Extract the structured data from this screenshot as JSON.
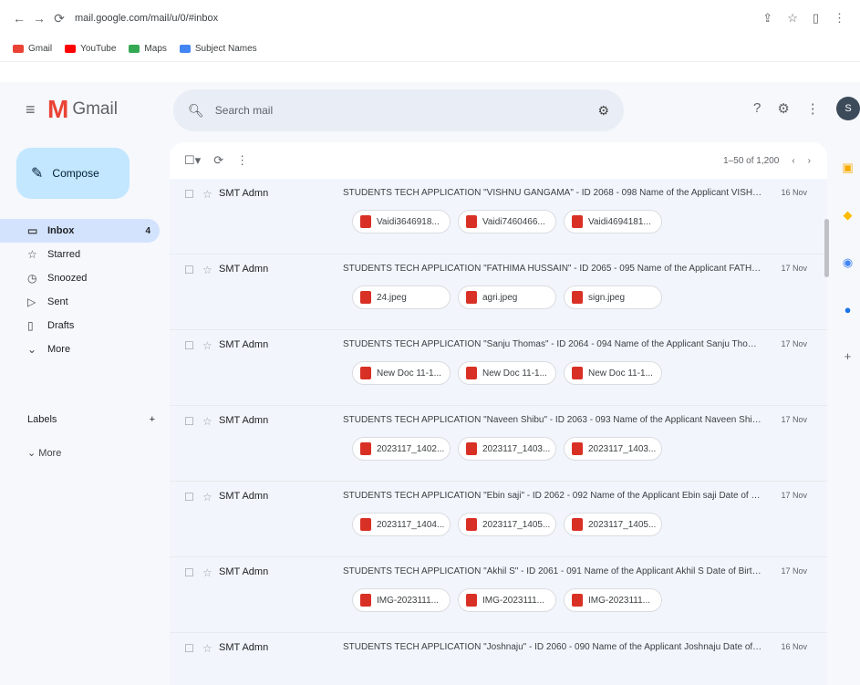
{
  "browser": {
    "url": "mail.google.com/mail/u/0/#inbox",
    "bookmarks": [
      "Gmail",
      "YouTube",
      "Maps",
      "Subject Names"
    ]
  },
  "app": {
    "logo_text": "Gmail",
    "search_placeholder": "Search mail",
    "compose_label": "Compose",
    "avatar_letter": "S"
  },
  "sidebar": {
    "items": [
      {
        "label": "Inbox",
        "count": "4",
        "icon": "inbox-icon"
      },
      {
        "label": "Starred",
        "icon": "star-icon"
      },
      {
        "label": "Snoozed",
        "icon": "clock-icon"
      },
      {
        "label": "Sent",
        "icon": "send-icon"
      },
      {
        "label": "Drafts",
        "icon": "draft-icon"
      },
      {
        "label": "More",
        "icon": "chevron-down-icon"
      }
    ],
    "labels_heading": "Labels",
    "labels_more": "More"
  },
  "toolbar": {
    "pager": "1–50 of 1,200"
  },
  "emails": [
    {
      "sender": "SMT Admn",
      "subject": "STUDENTS TECH APPLICATION \"VISHNU GANGAMA\" - ID 2068 - 098 Name of the Applicant VISHNU G...",
      "date": "16 Nov",
      "attachments": [
        "Vaidi3646918...",
        "Vaidi7460466...",
        "Vaidi4694181..."
      ]
    },
    {
      "sender": "SMT Admn",
      "subject": "STUDENTS TECH APPLICATION \"FATHIMA HUSSAIN\" - ID 2065 - 095 Name of the Applicant FATHIMA ...",
      "date": "17 Nov",
      "attachments": [
        "24.jpeg",
        "agri.jpeg",
        "sign.jpeg"
      ]
    },
    {
      "sender": "SMT Admn",
      "subject": "STUDENTS TECH APPLICATION \"Sanju Thomas\" - ID 2064 - 094 Name of the Applicant Sanju Thomas...",
      "date": "17 Nov",
      "attachments": [
        "New Doc 11-1...",
        "New Doc 11-1...",
        "New Doc 11-1..."
      ]
    },
    {
      "sender": "SMT Admn",
      "subject": "STUDENTS TECH APPLICATION \"Naveen Shibu\" - ID 2063 - 093 Name of the Applicant Naveen Shibu D...",
      "date": "17 Nov",
      "attachments": [
        "2023117_1402...",
        "2023117_1403...",
        "2023117_1403..."
      ]
    },
    {
      "sender": "SMT Admn",
      "subject": "STUDENTS TECH APPLICATION \"Ebin saji\" - ID 2062 - 092 Name of the Applicant Ebin saji Date of Bi...",
      "date": "17 Nov",
      "attachments": [
        "2023117_1404...",
        "2023117_1405...",
        "2023117_1405..."
      ]
    },
    {
      "sender": "SMT Admn",
      "subject": "STUDENTS TECH APPLICATION \"Akhil S\" - ID 2061 - 091 Name of the Applicant Akhil S Date of Birth 2...",
      "date": "17 Nov",
      "attachments": [
        "IMG-2023111...",
        "IMG-2023111...",
        "IMG-2023111..."
      ]
    },
    {
      "sender": "SMT Admn",
      "subject": "STUDENTS TECH APPLICATION \"Joshnaju\" - ID 2060 - 090 Name of the Applicant Joshnaju Date of Birth...",
      "date": "16 Nov",
      "attachments": []
    }
  ]
}
